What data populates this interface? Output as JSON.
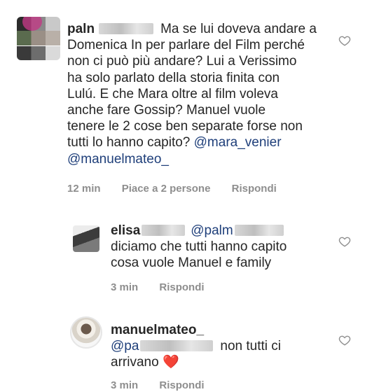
{
  "comments": [
    {
      "username": "paln",
      "text_line1": "Ma se lui doveva andare a",
      "text_rest": [
        "Domenica In per parlare del Film perché",
        "non ci può più andare? Lui a Verissimo",
        "ha solo parlato della storia finita con",
        "Lulú. E che Mara oltre al film voleva",
        "anche fare Gossip? Manuel vuole",
        "tenere le 2 cose ben separate forse non",
        "tutti lo hanno capito?"
      ],
      "mention1": "@mara_venier",
      "mention2": "@manuelmateo_",
      "time": "12 min",
      "likes": "Piace a 2 persone",
      "reply": "Rispondi"
    },
    {
      "username": "elisa",
      "mention": "@palm",
      "text": [
        "diciamo che tutti hanno capito",
        "cosa vuole Manuel e family"
      ],
      "time": "3 min",
      "reply": "Rispondi"
    },
    {
      "username": "manuelmateo_",
      "mention": "@pa",
      "text_line1": "non tutti ci",
      "text_line2": "arrivano",
      "emoji": "❤️",
      "time": "3 min",
      "reply": "Rispondi"
    }
  ],
  "icons": {
    "like": "heart-outline-icon"
  },
  "colors": {
    "text": "#262626",
    "meta": "#8e8e8e",
    "mention": "#1f3f7a",
    "heart": "#e0245e"
  }
}
